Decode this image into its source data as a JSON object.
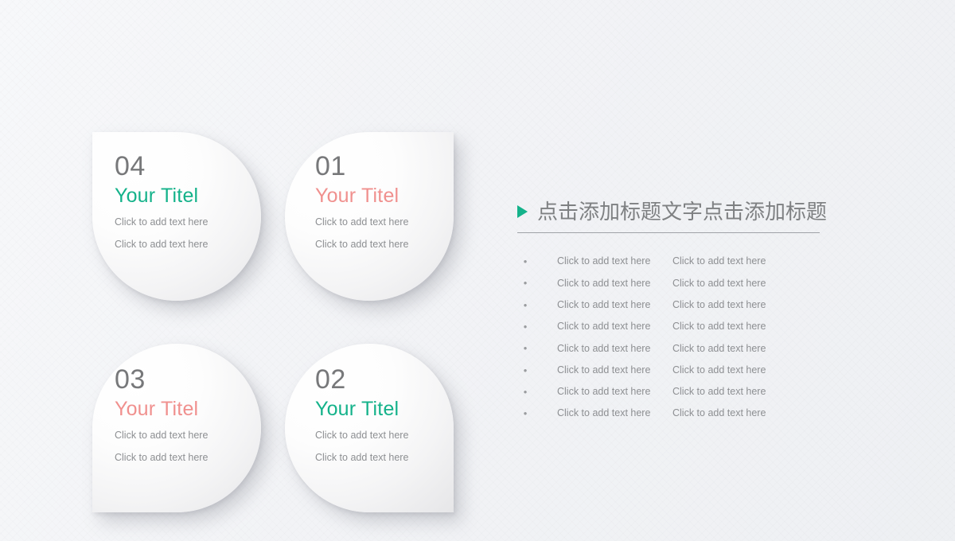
{
  "slide": {
    "background_color": "#f4f5f7",
    "accent_teal": "#14b28a",
    "accent_salmon": "#f0908e",
    "number_color": "#77787a",
    "body_text_color": "#8d8f92"
  },
  "cards": [
    {
      "number": "04",
      "title": "Your Titel",
      "accent": "teal",
      "lines": [
        "Click to add text here",
        "Click to add text here"
      ]
    },
    {
      "number": "01",
      "title": "Your Titel",
      "accent": "salmon",
      "lines": [
        "Click to add text here",
        "Click to add text here"
      ]
    },
    {
      "number": "03",
      "title": "Your Titel",
      "accent": "salmon",
      "lines": [
        "Click to add text here",
        "Click to add text here"
      ]
    },
    {
      "number": "02",
      "title": "Your Titel",
      "accent": "teal",
      "lines": [
        "Click to add text here",
        "Click to add text here"
      ]
    }
  ],
  "panel": {
    "bullet_icon": "triangle-right-icon",
    "title": "点击添加标题文字点击添加标题",
    "rows": [
      {
        "bullet": "•",
        "col1": "Click to add text here",
        "col2": "Click to add text here"
      },
      {
        "bullet": "•",
        "col1": "Click to add text here",
        "col2": "Click to add text here"
      },
      {
        "bullet": "•",
        "col1": "Click to add text here",
        "col2": "Click to add text here"
      },
      {
        "bullet": "•",
        "col1": "Click to add text here",
        "col2": "Click to add text here"
      },
      {
        "bullet": "•",
        "col1": "Click to add text here",
        "col2": "Click to add text here"
      },
      {
        "bullet": "•",
        "col1": "Click to add text here",
        "col2": "Click to add text here"
      },
      {
        "bullet": "•",
        "col1": "Click to add text here",
        "col2": "Click to add text here"
      },
      {
        "bullet": "•",
        "col1": "Click to add text here",
        "col2": "Click to add text here"
      }
    ]
  }
}
